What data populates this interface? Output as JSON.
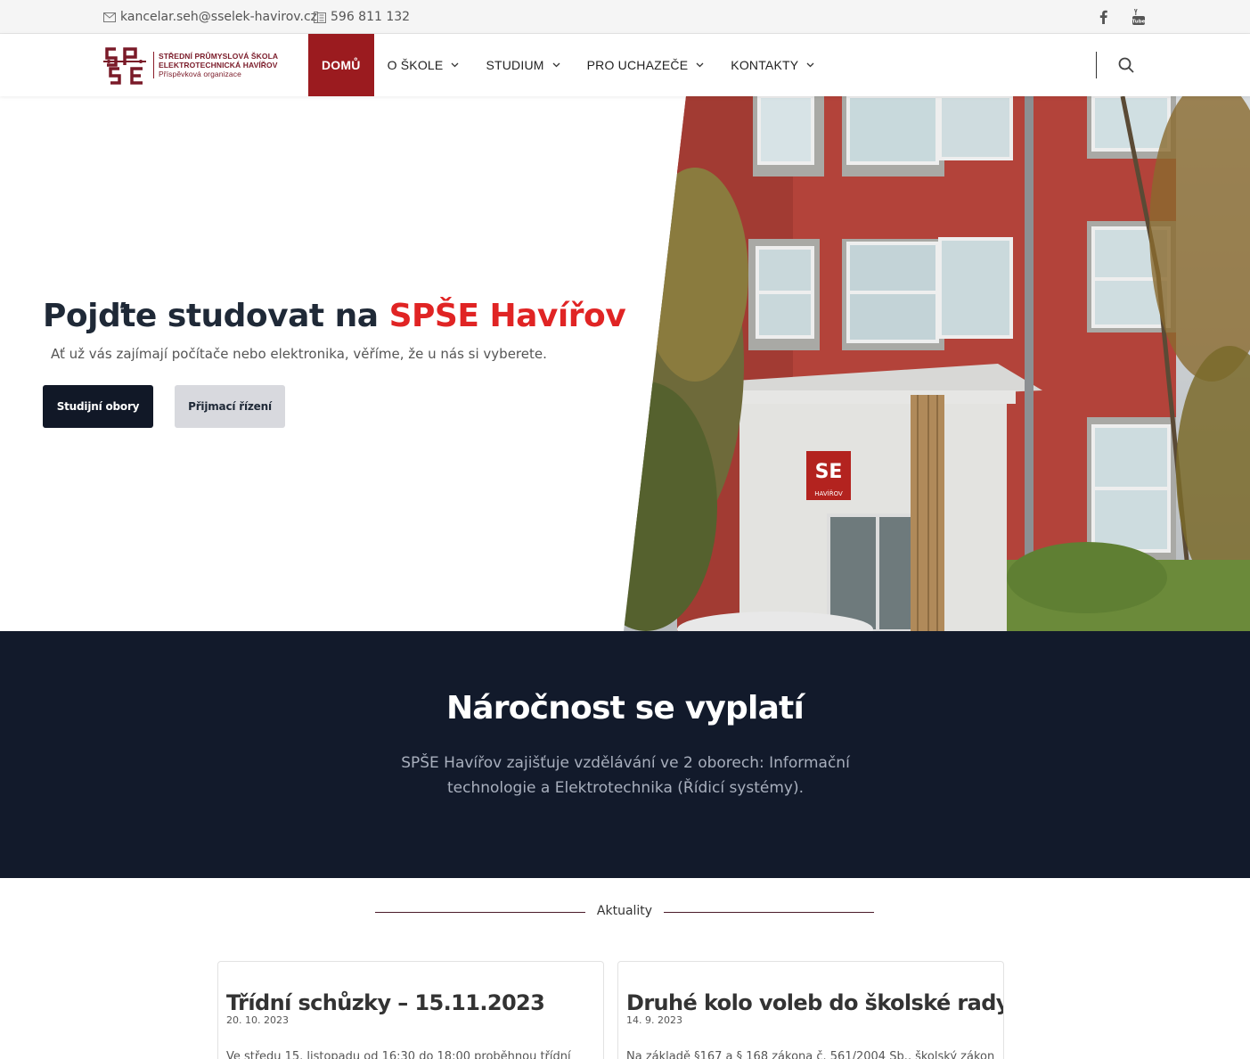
{
  "topbar": {
    "email": "kancelar.seh@sselek-havirov.cz",
    "phone": "596 811 132",
    "social": [
      "facebook-icon",
      "youtube-icon"
    ]
  },
  "header": {
    "logo": {
      "line1": "STŘEDNÍ PRŮMYSLOVÁ ŠKOLA",
      "line2": "ELEKTROTECHNICKÁ HAVÍŘOV",
      "line3": "Příspěvková organizace"
    },
    "nav": [
      {
        "label": "DOMŮ",
        "active": true
      },
      {
        "label": "O ŠKOLE",
        "dropdown": true
      },
      {
        "label": "STUDIUM",
        "dropdown": true
      },
      {
        "label": "PRO UCHAZEČE",
        "dropdown": true
      },
      {
        "label": "KONTAKTY",
        "dropdown": true
      }
    ]
  },
  "hero": {
    "title_prefix": "Pojďte studovat na ",
    "title_accent": "SPŠE Havířov",
    "subtitle": "Ať už vás zajímají počítače nebo elektronika, věříme, že u nás si vyberete.",
    "btn_primary": "Studijní obory",
    "btn_secondary": "Přijmací řízení",
    "sign_text": "HAVÍŘOV"
  },
  "band": {
    "title": "Náročnost se vyplatí",
    "text": "SPŠE Havířov zajišťuje vzdělávání ve 2 oborech: Informační technologie a Elektrotechnika (Řídicí systémy)."
  },
  "news": {
    "heading": "Aktuality",
    "items": [
      {
        "title": "Třídní schůzky – 15.11.2023",
        "date": "20. 10. 2023",
        "excerpt": "Ve středu 15. listopadu od 16:30 do 18:00 proběhnou třídní"
      },
      {
        "title": "Druhé kolo voleb do školské rady",
        "date": "14. 9. 2023",
        "excerpt": "Na základě §167 a § 168 zákona č. 561/2004 Sb., školský zákon"
      }
    ]
  },
  "colors": {
    "brand": "#9b1b1f",
    "accent": "#e02424",
    "dark": "#121a2b",
    "logo": "#7a1a28"
  }
}
